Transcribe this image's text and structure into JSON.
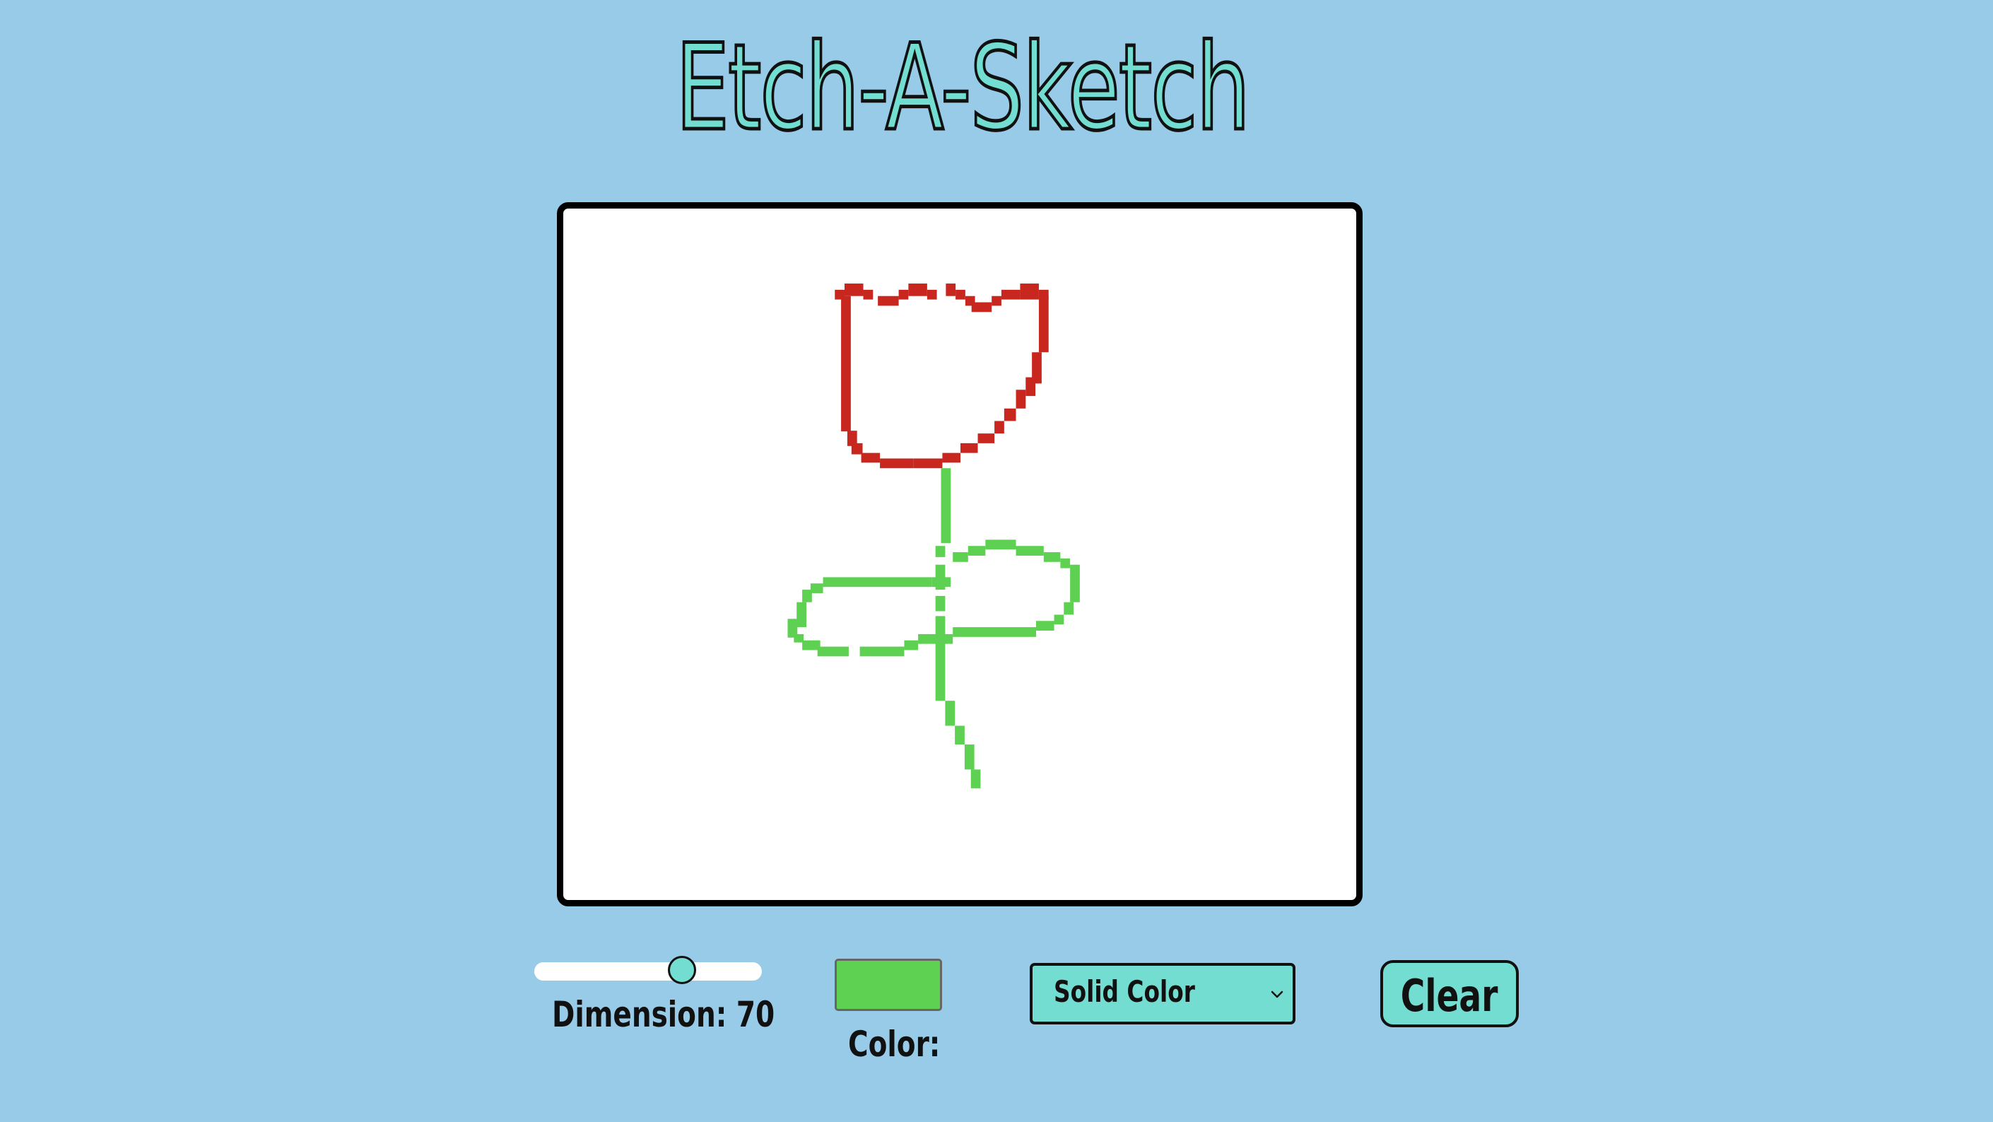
{
  "header": {
    "title": "Etch-A-Sketch"
  },
  "controls": {
    "dimension": {
      "label": "Dimension: 70",
      "value": 70,
      "fraction": 0.65
    },
    "color": {
      "label": "Color:",
      "value": "#5ed152"
    },
    "mode_select": {
      "selected": "Solid Color"
    },
    "clear_button": {
      "label": "Clear"
    }
  },
  "colors": {
    "background": "#97cbe8",
    "accent": "#72ddd0",
    "flower_red": "#c7271f",
    "stem_green": "#5ed152"
  }
}
